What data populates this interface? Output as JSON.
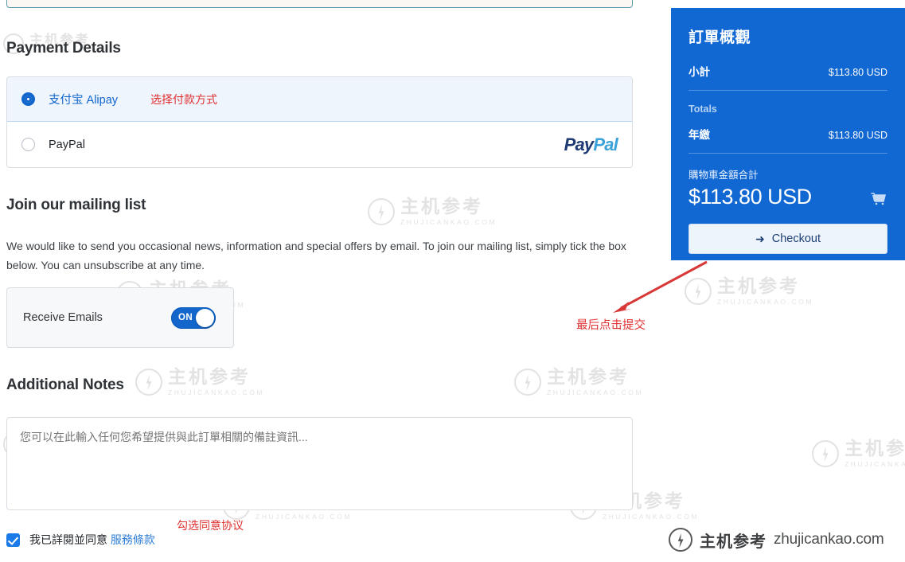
{
  "sections": {
    "payment_title": "Payment Details",
    "mailing_title": "Join our mailing list",
    "notes_title": "Additional Notes"
  },
  "payment": {
    "methods": [
      {
        "label": "支付宝 Alipay",
        "selected": true
      },
      {
        "label": "PayPal",
        "selected": false
      }
    ],
    "paypal_logo": {
      "part1": "Pay",
      "part2": "Pal"
    },
    "annotation": "选择付款方式"
  },
  "mailing": {
    "body": "We would like to send you occasional news, information and special offers by email. To join our mailing list, simply tick the box below. You can unsubscribe at any time.",
    "receive_label": "Receive Emails",
    "toggle_state": "ON"
  },
  "notes": {
    "placeholder": "您可以在此輸入任何您希望提供與此訂單相關的備註資訊...",
    "value": ""
  },
  "agreement": {
    "checked": true,
    "text": "我已詳閱並同意",
    "link": "服務條款",
    "annotation": "勾选同意协议"
  },
  "summary": {
    "title": "訂單概觀",
    "subtotal_label": "小計",
    "subtotal_value": "$113.80 USD",
    "totals_heading": "Totals",
    "period_label": "年繳",
    "period_value": "$113.80 USD",
    "cart_total_label": "購物車金額合計",
    "cart_total_value": "$113.80 USD",
    "checkout_label": "Checkout",
    "accent_color": "#1268d3"
  },
  "annotations": {
    "submit": "最后点击提交",
    "arrow_color": "#d93838"
  },
  "brand": {
    "cn": "主机参考",
    "en": "zhujicankao.com"
  },
  "watermark": {
    "cn": "主机参考",
    "en": "ZHUJICANKAO.COM"
  }
}
